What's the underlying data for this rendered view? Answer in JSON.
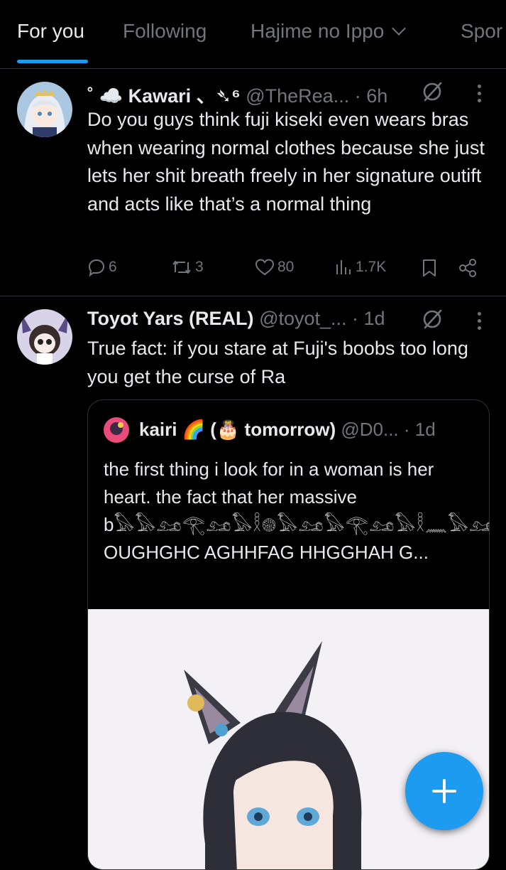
{
  "tabs": [
    {
      "label": "For you",
      "active": true
    },
    {
      "label": "Following"
    },
    {
      "label": "Hajime no Ippo"
    },
    {
      "label": "Spor"
    }
  ],
  "accent": "#1d9bf0",
  "tweets": [
    {
      "display_name": "˚ ☁️ Kawari 、➴⁶",
      "handle": "@TheRea...",
      "time": "· 6h",
      "text": "Do you guys think fuji kiseki even wears bras when wearing normal clothes because she just lets her shit breath freely in her signature outift and acts like that’s a normal thing",
      "replies": "6",
      "reposts": "3",
      "likes": "80",
      "views": "1.7K"
    },
    {
      "display_name": "Toyot Yars (REAL)",
      "handle": "@toyot_...",
      "time": "· 1d",
      "text": "True fact: if you stare at Fuji's boobs too long you get the curse of Ra",
      "quote": {
        "display_name": "kairi 🌈 (🎂 tomorrow)",
        "handle": "@D0...",
        "time": "· 1d",
        "text_1": "the first thing i look for in a woman is her heart. the fact that her massive b",
        "glyphs": "𓅃𓅃𓃭𓂀𓃭𓅃𓎛𓊗𓅃𓃭𓅃𓂀𓃭𓅃𓎛𓈖𓅃𓃭𓅃𓂀𓃭𓅃𓎛",
        "text_2": "CGUUAHG OUGHGHC AGHHFAG HHGGHAH G..."
      }
    }
  ],
  "icons": [
    "reply-icon",
    "repost-icon",
    "like-icon",
    "views-icon",
    "bookmark-icon",
    "share-icon",
    "grok-icon",
    "more-icon",
    "compose-icon"
  ]
}
